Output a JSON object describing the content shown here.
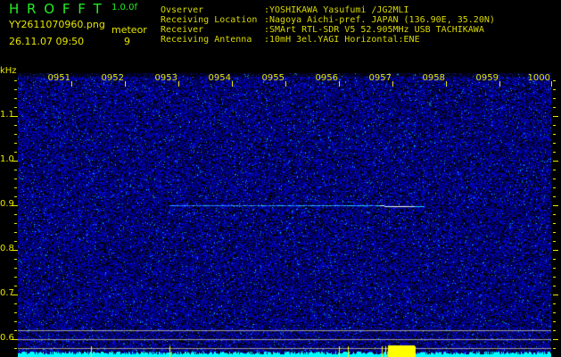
{
  "app": {
    "title": "H R O F F T",
    "version": "1.0.0f"
  },
  "file": {
    "name": "YY2611070960.png",
    "datetime": "26.11.07 09:50"
  },
  "detection": {
    "label": "meteor",
    "count": "9"
  },
  "station": [
    {
      "label": "Ovserver",
      "value": ":YOSHIKAWA Yasufumi /JG2MLI"
    },
    {
      "label": "Receiving Location",
      "value": ":Nagoya Aichi-pref. JAPAN (136.90E, 35.20N)"
    },
    {
      "label": "Receiver",
      "value": ":SMArt RTL-SDR V5 52.905MHz USB TACHIKAWA"
    },
    {
      "label": "Receiving Antenna",
      "value": ":10mH 3el.YAGI Horizontal:ENE"
    }
  ],
  "axis": {
    "y_unit": "kHz",
    "y_labels": [
      "1.1",
      "1.0",
      "0.9",
      "0.8",
      "0.7",
      "0.6"
    ],
    "x_labels": [
      "0951",
      "0952",
      "0953",
      "0954",
      "0955",
      "0956",
      "0957",
      "0958",
      "0959",
      "1000"
    ]
  },
  "colors": {
    "background": "#000000",
    "noise": "#1a1aff",
    "signal": "#00ffff",
    "text": "#e6e600",
    "title": "#22ee22"
  }
}
